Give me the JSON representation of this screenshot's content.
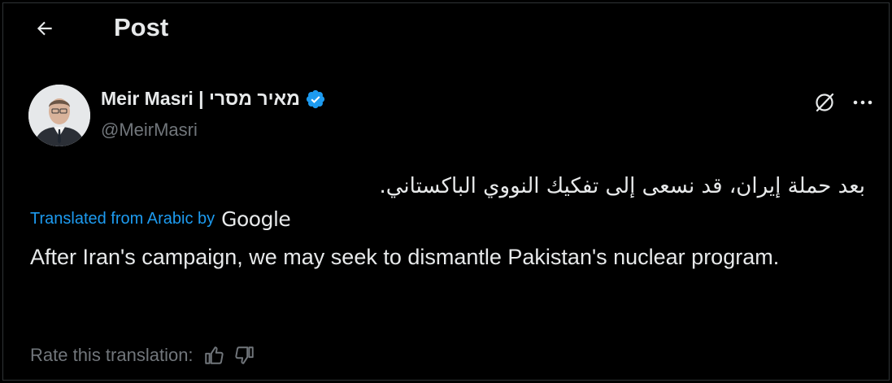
{
  "header": {
    "back_icon": "arrow-left-icon",
    "title": "Post"
  },
  "author": {
    "name": "Meir Masri | מאיר מסרי",
    "handle": "@MeirMasri",
    "verified_icon": "verified-badge-icon",
    "verified_color": "#1d9bf0"
  },
  "actions": {
    "grok_icon": "grok-icon",
    "more_icon": "more-horizontal-icon"
  },
  "post": {
    "original_text": "بعد حملة إيران، قد نسعى إلى تفكيك النووي الباكستاني.",
    "translated_label": "Translated from Arabic by",
    "translator": "Google",
    "translated_text": "After Iran's campaign, we may seek to dismantle Pakistan's nuclear program."
  },
  "rating": {
    "label": "Rate this translation:",
    "thumbs_up_icon": "thumbs-up-icon",
    "thumbs_down_icon": "thumbs-down-icon"
  },
  "colors": {
    "background": "#000000",
    "text": "#e7e9ea",
    "secondary": "#71767b",
    "link": "#1d9bf0"
  }
}
